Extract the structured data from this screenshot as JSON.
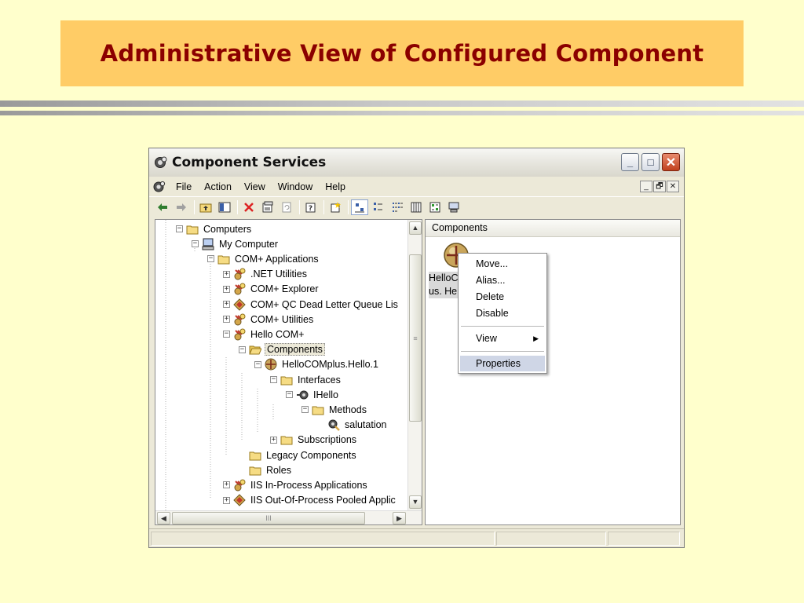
{
  "slide": {
    "title": "Administrative View of Configured Component",
    "colors": {
      "background": "#FFFFCC",
      "title_box": "#FFCC66",
      "title_text": "#8B0000"
    }
  },
  "window": {
    "title": "Component Services",
    "controls": {
      "minimize": "_",
      "maximize": "□",
      "close": "✕"
    },
    "menu": [
      "File",
      "Action",
      "View",
      "Window",
      "Help"
    ],
    "mdi_controls": {
      "minimize": "_",
      "restore": "🗗",
      "close": "✕"
    },
    "toolbar_icons": [
      "back-arrow-icon",
      "forward-arrow-icon",
      "up-folder-icon",
      "show-hide-tree-icon",
      "delete-icon",
      "properties-icon",
      "refresh-icon",
      "help-icon",
      "new-icon",
      "large-icons-view-icon",
      "small-icons-view-icon",
      "list-view-icon",
      "detail-view-icon",
      "status-view-icon",
      "computer-icon"
    ]
  },
  "tree": {
    "items": [
      {
        "label": "Computers",
        "icon": "folder-icon",
        "expander": "−",
        "depth": 0
      },
      {
        "label": "My Computer",
        "icon": "computer-icon",
        "expander": "−",
        "depth": 1
      },
      {
        "label": "COM+ Applications",
        "icon": "folder-icon",
        "expander": "−",
        "depth": 2
      },
      {
        "label": ".NET Utilities",
        "icon": "com-app-icon",
        "expander": "+",
        "depth": 3
      },
      {
        "label": "COM+ Explorer",
        "icon": "com-app-icon",
        "expander": "+",
        "depth": 3
      },
      {
        "label": "COM+ QC Dead Letter Queue Lis",
        "icon": "diamond-app-icon",
        "expander": "+",
        "depth": 3
      },
      {
        "label": "COM+ Utilities",
        "icon": "com-app-icon",
        "expander": "+",
        "depth": 3
      },
      {
        "label": "Hello COM+",
        "icon": "com-app-icon",
        "expander": "−",
        "depth": 3
      },
      {
        "label": "Components",
        "icon": "open-folder-icon",
        "expander": "−",
        "depth": 4,
        "selected": true
      },
      {
        "label": "HelloCOMplus.Hello.1",
        "icon": "component-ball-icon",
        "expander": "−",
        "depth": 5
      },
      {
        "label": "Interfaces",
        "icon": "folder-icon",
        "expander": "−",
        "depth": 6
      },
      {
        "label": "IHello",
        "icon": "interface-icon",
        "expander": "−",
        "depth": 7
      },
      {
        "label": "Methods",
        "icon": "folder-icon",
        "expander": "−",
        "depth": 8
      },
      {
        "label": "salutation",
        "icon": "method-icon",
        "expander": "",
        "depth": 9
      },
      {
        "label": "Subscriptions",
        "icon": "folder-icon",
        "expander": "+",
        "depth": 6
      },
      {
        "label": "Legacy Components",
        "icon": "folder-icon",
        "expander": "",
        "depth": 4
      },
      {
        "label": "Roles",
        "icon": "folder-icon",
        "expander": "",
        "depth": 4
      },
      {
        "label": "IIS In-Process Applications",
        "icon": "com-app-icon",
        "expander": "+",
        "depth": 3
      },
      {
        "label": "IIS Out-Of-Process Pooled Applic",
        "icon": "diamond-app-icon",
        "expander": "+",
        "depth": 3
      }
    ],
    "scroll": {
      "up": "▲",
      "down": "▼",
      "left": "◀",
      "right": "▶",
      "thumb_grip": "≡",
      "hthumb_grip": "III"
    }
  },
  "list": {
    "header": "Components",
    "item_label_line1": "HelloC",
    "item_label_line2": "us. He"
  },
  "context_menu": {
    "items": [
      {
        "label": "Move...",
        "type": "item"
      },
      {
        "label": "Alias...",
        "type": "item"
      },
      {
        "label": "Delete",
        "type": "item"
      },
      {
        "label": "Disable",
        "type": "item"
      },
      {
        "type": "separator"
      },
      {
        "label": "View",
        "type": "submenu",
        "arrow": "▶"
      },
      {
        "type": "separator"
      },
      {
        "label": "Properties",
        "type": "item",
        "highlighted": true
      }
    ]
  }
}
